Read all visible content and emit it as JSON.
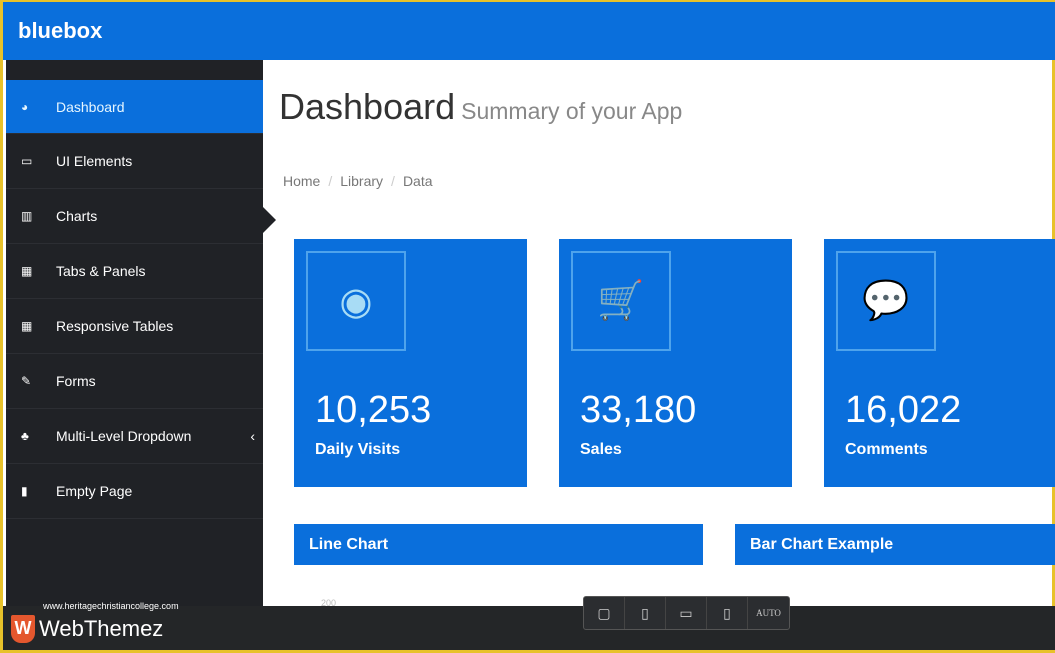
{
  "brand": "bluebox",
  "sidebar": {
    "items": [
      {
        "label": "Dashboard",
        "icon": "dashboard-icon",
        "glyph": "◕"
      },
      {
        "label": "UI Elements",
        "icon": "desktop-icon",
        "glyph": "▭"
      },
      {
        "label": "Charts",
        "icon": "bar-chart-icon",
        "glyph": "▥"
      },
      {
        "label": "Tabs & Panels",
        "icon": "panels-icon",
        "glyph": "▦"
      },
      {
        "label": "Responsive Tables",
        "icon": "table-icon",
        "glyph": "▦"
      },
      {
        "label": "Forms",
        "icon": "edit-icon",
        "glyph": "✎"
      },
      {
        "label": "Multi-Level Dropdown",
        "icon": "sitemap-icon",
        "glyph": "♣"
      },
      {
        "label": "Empty Page",
        "icon": "file-icon",
        "glyph": "▮"
      }
    ]
  },
  "header": {
    "title": "Dashboard",
    "subtitle": "Summary of your App"
  },
  "breadcrumb": [
    "Home",
    "Library",
    "Data"
  ],
  "cards": [
    {
      "value": "10,253",
      "label": "Daily Visits",
      "icon": "eye-icon",
      "glyph": "◉"
    },
    {
      "value": "33,180",
      "label": "Sales",
      "icon": "cart-icon",
      "glyph": "🛒"
    },
    {
      "value": "16,022",
      "label": "Comments",
      "icon": "comments-icon",
      "glyph": "💬"
    }
  ],
  "panels": [
    "Line Chart",
    "Bar Chart Example"
  ],
  "chart_tick": "200",
  "footer": {
    "url": "www.heritagechristiancollege.com",
    "logo": "WebThemez",
    "devices": [
      "▢",
      "▯",
      "▭",
      "▯",
      "AUTO"
    ]
  },
  "colors": {
    "primary": "#0a6fdc",
    "sidebar": "#202226"
  }
}
